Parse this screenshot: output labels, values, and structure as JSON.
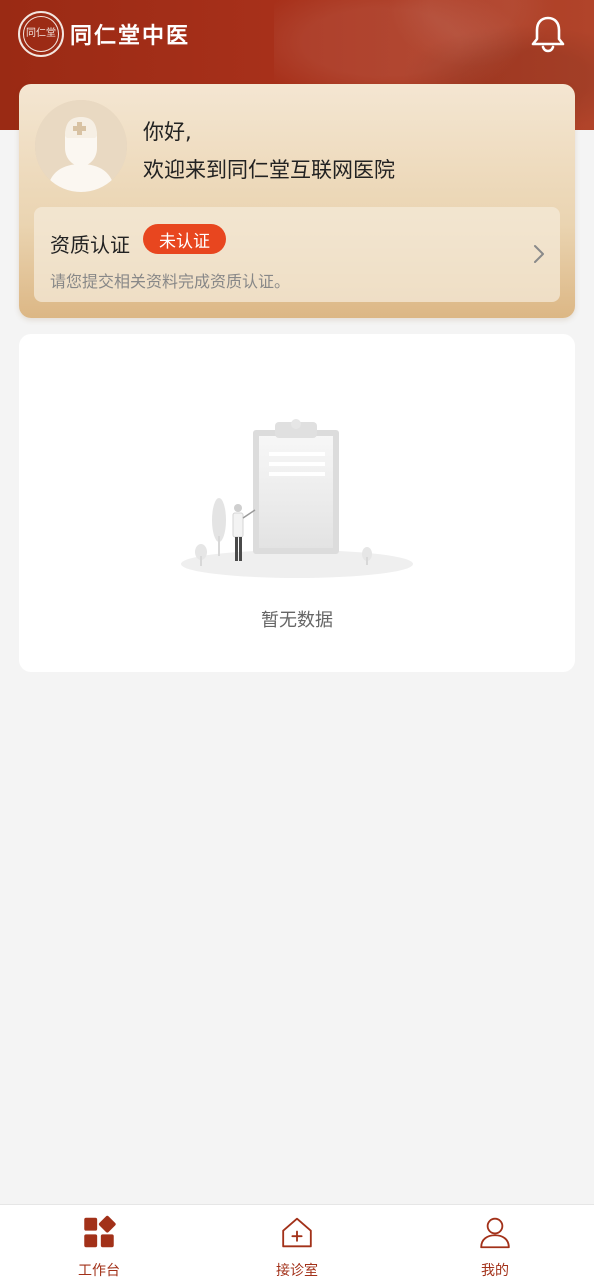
{
  "header": {
    "seal_text": "同仁堂",
    "brand_name": "同仁堂中医",
    "bell_icon": "bell-icon",
    "brand_color": "#a7301a"
  },
  "profile": {
    "greeting": "你好,",
    "welcome": "欢迎来到同仁堂互联网医院",
    "avatar_icon": "doctor-avatar-icon"
  },
  "qualification": {
    "title": "资质认证",
    "badge": "未认证",
    "subtitle": "请您提交相关资料完成资质认证。",
    "badge_color": "#e8461f",
    "chevron_icon": "chevron-right-icon"
  },
  "empty_state": {
    "text": "暂无数据",
    "illustration": "empty-clipboard-illustration"
  },
  "tabbar": {
    "tabs": [
      {
        "label": "工作台",
        "icon": "workbench-icon"
      },
      {
        "label": "接诊室",
        "icon": "clinic-icon"
      },
      {
        "label": "我的",
        "icon": "user-icon"
      }
    ],
    "active_color": "#a23119"
  }
}
